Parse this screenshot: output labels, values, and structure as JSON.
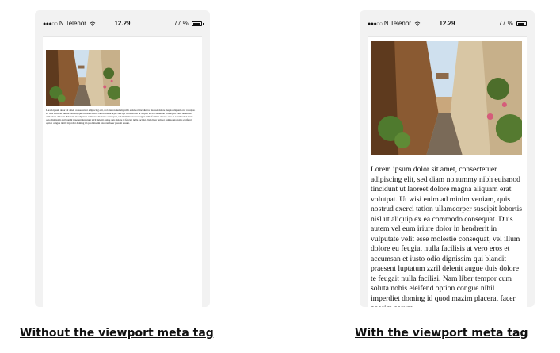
{
  "status_bar": {
    "carrier": "N Telenor",
    "time": "12.29",
    "battery": "77 %",
    "icons": [
      "signal-dots-icon",
      "wifi-icon",
      "battery-icon"
    ]
  },
  "lorem_text": "Lorem ipsum dolor sit amet, consectetuer adipiscing elit, sed diam nonummy nibh euismod tincidunt ut laoreet dolore magna aliquam erat volutpat. Ut wisi enim ad minim veniam, quis nostrud exerci tation ullamcorper suscipit lobortis nisl ut aliquip ex ea commodo consequat. Duis autem vel eum iriure dolor in hendrerit in vulputate velit esse molestie consequat, vel illum dolore eu feugiat nulla facilisis at vero eros et accumsan et iusto odio dignissim qui blandit praesent luptatum zzril delenit augue duis dolore te feugait nulla facilisi. Nam liber tempor cum soluta nobis eleifend option congue nihil imperdiet doming id quod mazim placerat facer possim assum.",
  "captions": {
    "without": "Without the viewport meta tag",
    "with": "With the viewport meta tag"
  },
  "colors": {
    "frame": "#f2f2f2",
    "screen": "#ffffff",
    "text": "#111111"
  }
}
